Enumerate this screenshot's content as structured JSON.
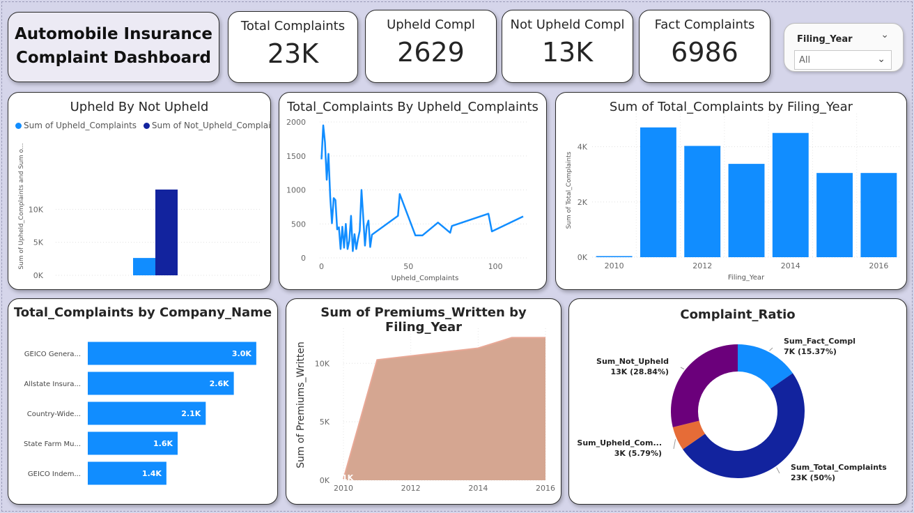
{
  "dashboard_title": "Automobile Insurance Complaint Dashboard",
  "kpis": [
    {
      "label": "Total Complaints",
      "value": "23K"
    },
    {
      "label": "Upheld Compl",
      "value": "2629"
    },
    {
      "label": "Not Upheld Compl",
      "value": "13K"
    },
    {
      "label": "Fact Complaints",
      "value": "6986"
    }
  ],
  "slicer": {
    "label": "Filing_Year",
    "value": "All"
  },
  "colors": {
    "blue": "#118dff",
    "navy": "#12239e",
    "orange": "#e66c37",
    "purple": "#6b007b",
    "salmon": "#d5a691",
    "salmon_line": "#e8a896"
  },
  "icons": {
    "slicer_expand": "chevron-down-icon",
    "slicer_dropdown": "chevron-down-icon"
  },
  "chart_data": [
    {
      "id": "upheld-by-not-upheld",
      "type": "bar",
      "title": "Upheld By Not Upheld",
      "ylabel": "Sum of Upheld_Complaints and Sum o...",
      "yticks": [
        "0K",
        "5K",
        "10K"
      ],
      "ylim": [
        0,
        15000
      ],
      "series": [
        {
          "name": "Sum of Upheld_Complaints",
          "values": [
            2629
          ]
        },
        {
          "name": "Sum of Not_Upheld_Complai...",
          "values": [
            13000
          ]
        }
      ],
      "legend": "top-left"
    },
    {
      "id": "total-by-upheld",
      "type": "line",
      "title": "Total_Complaints By Upheld_Complaints",
      "xlabel": "Upheld_Complaints",
      "xticks": [
        "0",
        "50",
        "100"
      ],
      "yticks": [
        "0",
        "500",
        "1000",
        "1500",
        "2000"
      ],
      "xlim": [
        -1,
        118
      ],
      "ylim": [
        0,
        2000
      ],
      "points": [
        [
          0,
          1450
        ],
        [
          1,
          1950
        ],
        [
          2,
          1700
        ],
        [
          3,
          1150
        ],
        [
          4,
          1530
        ],
        [
          5,
          900
        ],
        [
          6,
          510
        ],
        [
          7,
          880
        ],
        [
          8,
          850
        ],
        [
          9,
          420
        ],
        [
          10,
          450
        ],
        [
          11,
          130
        ],
        [
          12,
          460
        ],
        [
          13,
          150
        ],
        [
          14,
          500
        ],
        [
          15,
          130
        ],
        [
          16,
          250
        ],
        [
          17,
          620
        ],
        [
          18,
          100
        ],
        [
          19,
          350
        ],
        [
          20,
          130
        ],
        [
          21,
          280
        ],
        [
          22,
          400
        ],
        [
          23,
          1000
        ],
        [
          24,
          600
        ],
        [
          25,
          180
        ],
        [
          26,
          470
        ],
        [
          27,
          550
        ],
        [
          28,
          160
        ],
        [
          29,
          340
        ],
        [
          44,
          620
        ],
        [
          45,
          940
        ],
        [
          54,
          330
        ],
        [
          58,
          330
        ],
        [
          67,
          520
        ],
        [
          74,
          370
        ],
        [
          75,
          470
        ],
        [
          96,
          650
        ],
        [
          98,
          390
        ],
        [
          116,
          610
        ]
      ]
    },
    {
      "id": "total-by-year",
      "type": "bar",
      "title": "Sum of Total_Complaints by Filing_Year",
      "xlabel": "Filing_Year",
      "ylabel": "Sum of Total_Complaints",
      "xticks": [
        "2010",
        "2012",
        "2014",
        "2016"
      ],
      "yticks": [
        "0K",
        "2K",
        "4K"
      ],
      "ylim": [
        0,
        5200
      ],
      "categories": [
        "2010",
        "2011",
        "2012",
        "2013",
        "2014",
        "2015",
        "2016"
      ],
      "values": [
        40,
        4700,
        4030,
        3380,
        4500,
        3050,
        3050
      ]
    },
    {
      "id": "total-by-company",
      "type": "bar",
      "orientation": "horizontal",
      "title": "Total_Complaints by Company_Name",
      "categories": [
        "GEICO Genera...",
        "Allstate Insura...",
        "Country-Wide...",
        "State Farm Mu...",
        "GEICO Indem..."
      ],
      "values": [
        3000,
        2600,
        2100,
        1600,
        1400
      ],
      "labels": [
        "3.0K",
        "2.6K",
        "2.1K",
        "1.6K",
        "1.4K"
      ],
      "xlim": [
        0,
        3200
      ]
    },
    {
      "id": "premiums-by-year",
      "type": "area",
      "title": "Sum of Premiums_Written by Filing_Year",
      "ylabel": "Sum of Premiums_Written",
      "xticks": [
        "2010",
        "2012",
        "2014",
        "2016"
      ],
      "yticks": [
        "0K",
        "5K",
        "10K"
      ],
      "xlim": [
        2010,
        2016
      ],
      "ylim": [
        0,
        13000
      ],
      "x": [
        2010,
        2011,
        2014,
        2015,
        2016
      ],
      "values": [
        100,
        10300,
        11300,
        12200,
        12200
      ],
      "data_labels": [
        "1K"
      ]
    },
    {
      "id": "complaint-ratio",
      "type": "pie",
      "title": "Complaint_Ratio",
      "slices": [
        {
          "name": "Sum_Fact_Compl",
          "label": "7K (15.37%)",
          "percent": 15.37,
          "color": "#118dff"
        },
        {
          "name": "Sum_Total_Complaints",
          "label": "23K (50%)",
          "percent": 50.0,
          "color": "#12239e"
        },
        {
          "name": "Sum_Upheld_Com...",
          "label": "3K (5.79%)",
          "percent": 5.79,
          "color": "#e66c37"
        },
        {
          "name": "Sum_Not_Upheld",
          "label": "13K (28.84%)",
          "percent": 28.84,
          "color": "#6b007b"
        }
      ]
    }
  ]
}
